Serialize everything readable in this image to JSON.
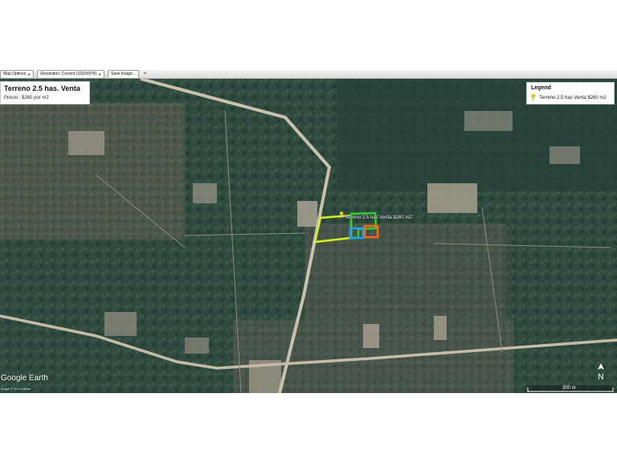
{
  "toolbar": {
    "map_options": "Map Options",
    "resolution": "Resolution: Current (1920x974)",
    "save_image": "Save Image...",
    "close": "×"
  },
  "info_box": {
    "title": "Terreno 2.5 has. Venta",
    "subtitle": "Precio : $260 por m2"
  },
  "legend": {
    "title": "Legend",
    "items": [
      {
        "label": "Terreno 2.5 has Venta $260 m2",
        "icon": "yellow-pushpin-icon",
        "color": "#e6e600"
      }
    ]
  },
  "placemark": {
    "label": "Terreno 2.5 has Venta $260 m2",
    "icon": "yellow-pushpin-icon"
  },
  "branding": {
    "logo": "Google Earth",
    "copyright": "Image © 2014 Airbus"
  },
  "compass": {
    "label": "N",
    "icon": "north-arrow-icon"
  },
  "scale_bar": {
    "label": "300 m"
  },
  "colors": {
    "polygon_yellow": "#d4ee2a",
    "polygon_green": "#2fd12f",
    "polygon_blue": "#1ea0ff",
    "polygon_orange": "#ff6a10",
    "vegetation": "#2f4a3e"
  }
}
